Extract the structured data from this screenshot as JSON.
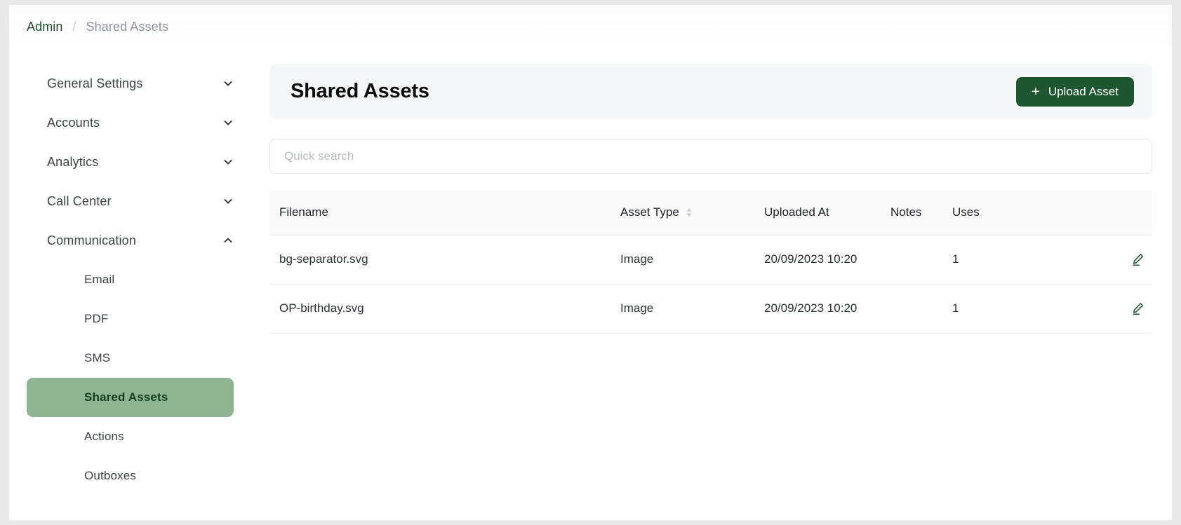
{
  "breadcrumb": {
    "root": "Admin",
    "separator": "/",
    "current": "Shared Assets"
  },
  "sidebar": {
    "groups": [
      {
        "label": "General Settings",
        "icon": "chevron-down-icon",
        "expanded": false
      },
      {
        "label": "Accounts",
        "icon": "chevron-down-icon",
        "expanded": false
      },
      {
        "label": "Analytics",
        "icon": "chevron-down-icon",
        "expanded": false
      },
      {
        "label": "Call Center",
        "icon": "chevron-down-icon",
        "expanded": false
      },
      {
        "label": "Communication",
        "icon": "chevron-up-icon",
        "expanded": true
      }
    ],
    "sub_items": [
      {
        "label": "Email",
        "active": false
      },
      {
        "label": "PDF",
        "active": false
      },
      {
        "label": "SMS",
        "active": false
      },
      {
        "label": "Shared Assets",
        "active": true
      },
      {
        "label": "Actions",
        "active": false
      },
      {
        "label": "Outboxes",
        "active": false
      }
    ]
  },
  "header": {
    "title": "Shared Assets",
    "upload_button": {
      "label": "Upload Asset",
      "icon": "plus-icon",
      "color": "#1d5630"
    }
  },
  "search": {
    "placeholder": "Quick search",
    "value": ""
  },
  "table": {
    "columns": [
      {
        "label": "Filename",
        "sortable": false
      },
      {
        "label": "Asset Type",
        "sortable": true,
        "sort_icon": "sort-arrows-icon"
      },
      {
        "label": "Uploaded At",
        "sortable": false
      },
      {
        "label": "Notes",
        "sortable": false
      },
      {
        "label": "Uses",
        "sortable": false
      }
    ],
    "rows": [
      {
        "filename": "bg-separator.svg",
        "asset_type": "Image",
        "uploaded_at": "20/09/2023 10:20",
        "notes": "",
        "uses": "1",
        "action_icon": "edit-pencil-icon"
      },
      {
        "filename": "OP-birthday.svg",
        "asset_type": "Image",
        "uploaded_at": "20/09/2023 10:20",
        "notes": "",
        "uses": "1",
        "action_icon": "edit-pencil-icon"
      }
    ]
  },
  "colors": {
    "accent_dark_green": "#1d5630",
    "active_sidebar_bg": "#8fb492",
    "active_sidebar_text": "#15401f",
    "link_green": "#1f4d2e",
    "muted_text": "#8c92a0"
  }
}
